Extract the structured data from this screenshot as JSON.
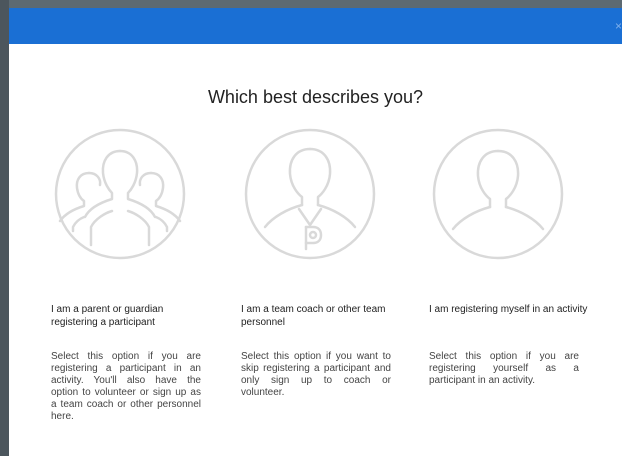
{
  "dialog": {
    "close_label": "×",
    "title": "Which best describes you?"
  },
  "options": [
    {
      "icon": "group-icon",
      "heading": "I am a parent or guardian registering a participant",
      "description": "Select this option if you are registering a participant in an activity. You'll also have the option to volunteer or sign up as a team coach or other personnel here."
    },
    {
      "icon": "coach-whistle-icon",
      "heading": "I am a team coach or other team personnel",
      "description": "Select this option if you want to skip registering a participant and only sign up to coach or volunteer."
    },
    {
      "icon": "single-user-icon",
      "heading": "I am registering myself in an activity",
      "description": "Select this option if you are registering yourself as a participant in an activity."
    }
  ],
  "colors": {
    "header": "#1a6fd4",
    "icon_stroke": "#d9d9d9"
  }
}
